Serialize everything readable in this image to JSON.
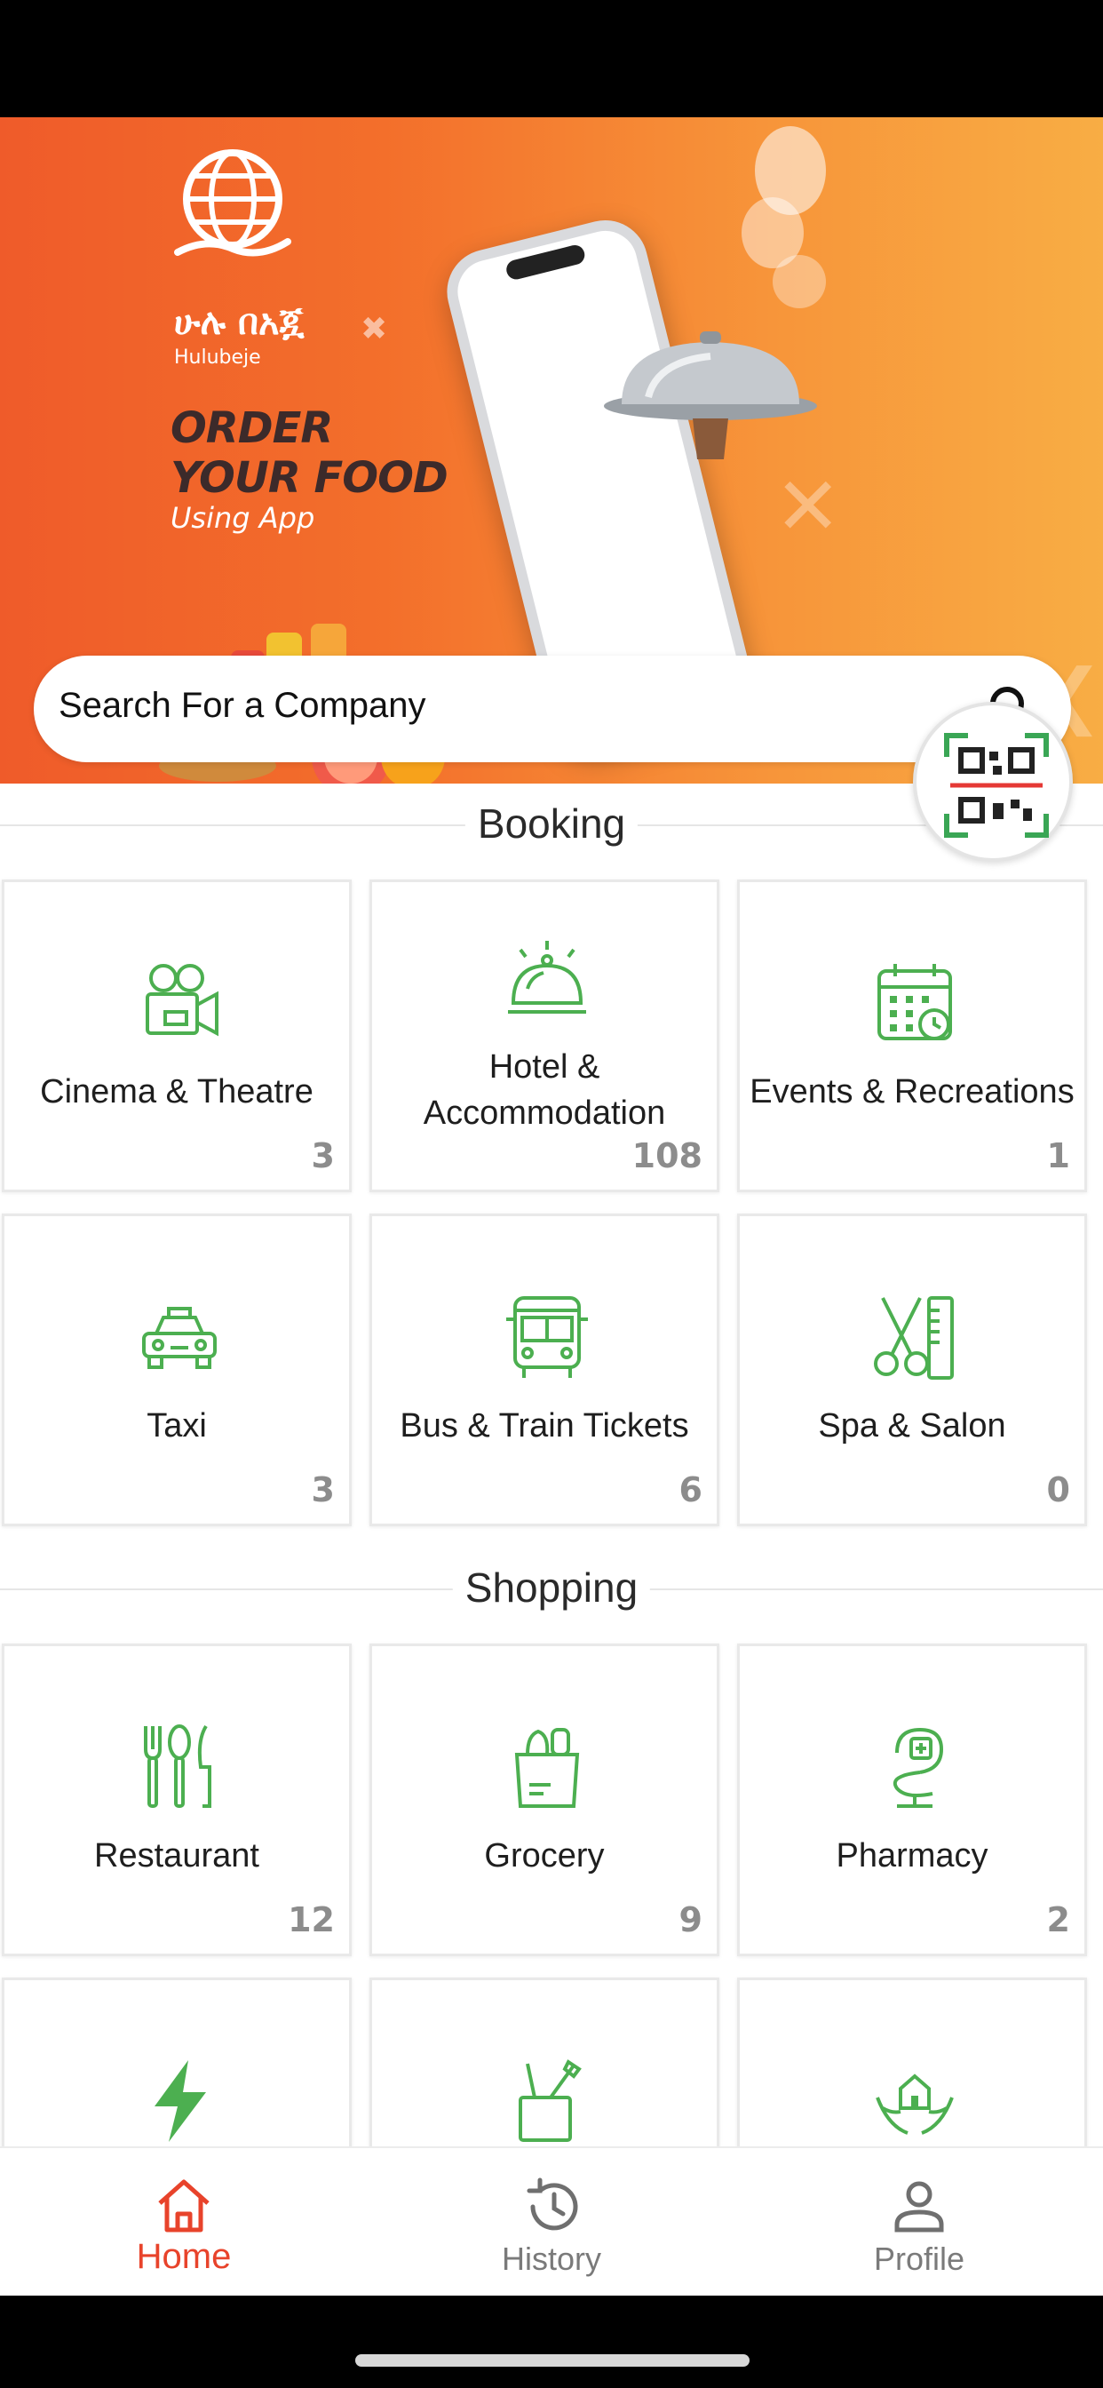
{
  "banner": {
    "brand_amharic": "ሁሉ በአጇ",
    "brand_latin": "Hulubeje",
    "promo_line1": "ORDER",
    "promo_line2": "YOUR FOOD",
    "promo_line3": "Using App",
    "carousel_dot_count": 7,
    "carousel_active_index": 2
  },
  "search": {
    "placeholder": "Search For a Company"
  },
  "sections": {
    "booking": {
      "title": "Booking",
      "items": [
        {
          "label": "Cinema & Theatre",
          "count": "3",
          "icon": "cinema-icon"
        },
        {
          "label": "Hotel & Accommodation",
          "count": "108",
          "icon": "hotel-bell-icon"
        },
        {
          "label": "Events & Recreations",
          "count": "1",
          "icon": "calendar-icon"
        },
        {
          "label": "Taxi",
          "count": "3",
          "icon": "taxi-icon"
        },
        {
          "label": "Bus & Train Tickets",
          "count": "6",
          "icon": "bus-icon"
        },
        {
          "label": "Spa & Salon",
          "count": "0",
          "icon": "scissors-comb-icon"
        }
      ]
    },
    "shopping": {
      "title": "Shopping",
      "items": [
        {
          "label": "Restaurant",
          "count": "12",
          "icon": "cutlery-icon"
        },
        {
          "label": "Grocery",
          "count": "9",
          "icon": "grocery-bag-icon"
        },
        {
          "label": "Pharmacy",
          "count": "2",
          "icon": "pharmacy-icon"
        },
        {
          "label": "",
          "count": "",
          "icon": "lightning-icon"
        },
        {
          "label": "",
          "count": "",
          "icon": "stationery-icon"
        },
        {
          "label": "",
          "count": "",
          "icon": "home-care-icon"
        }
      ]
    }
  },
  "nav": {
    "items": [
      {
        "label": "Home",
        "icon": "home-icon",
        "active": true
      },
      {
        "label": "History",
        "icon": "history-icon",
        "active": false
      },
      {
        "label": "Profile",
        "icon": "profile-icon",
        "active": false
      }
    ]
  },
  "colors": {
    "accent_green": "#4caf50",
    "active_red": "#e8432b",
    "banner_orange": "#f36f2b"
  }
}
